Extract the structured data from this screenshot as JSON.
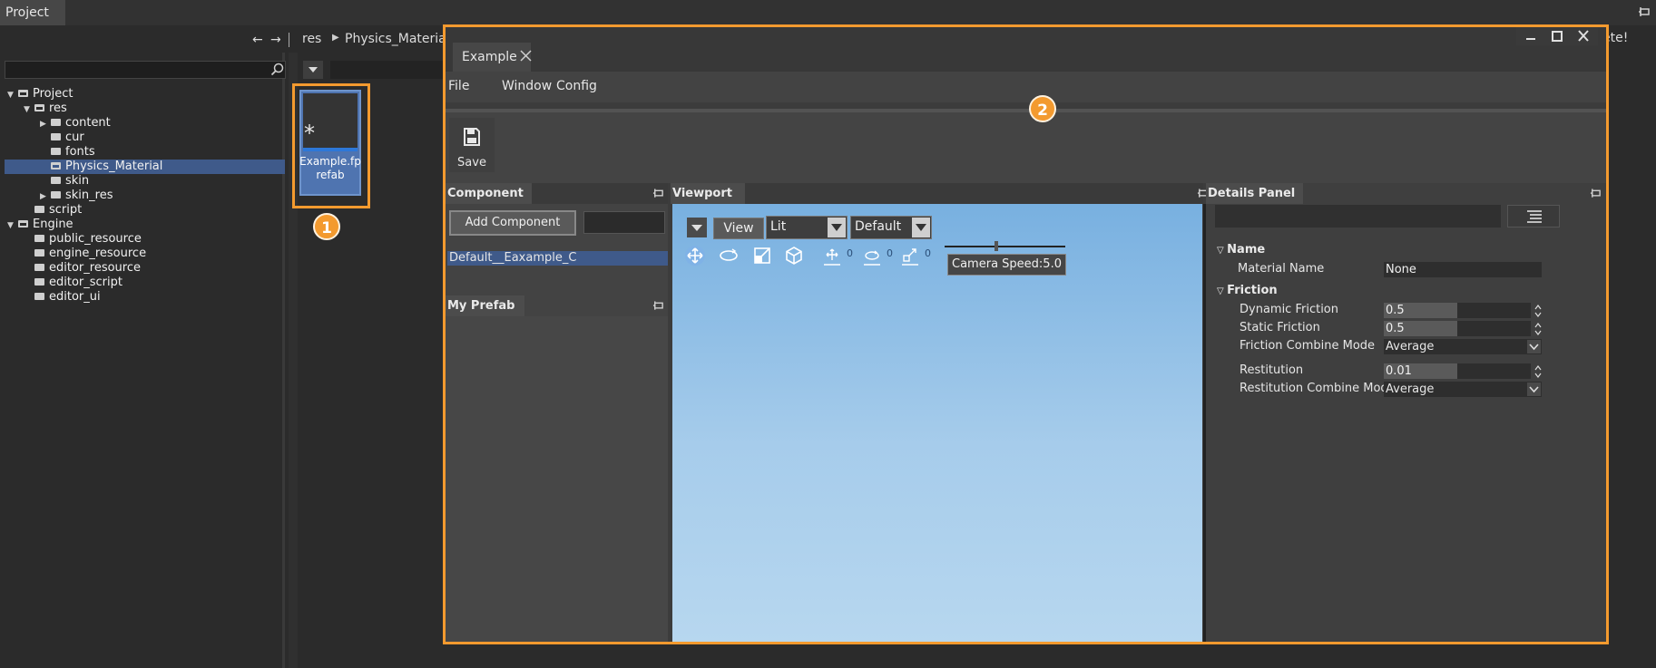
{
  "project": {
    "tab_label": "Project",
    "breadcrumb": [
      "res",
      "Physics_Material"
    ],
    "tree": [
      {
        "label": "Project",
        "depth": 0,
        "arrow": "open",
        "open": true
      },
      {
        "label": "res",
        "depth": 1,
        "arrow": "open",
        "open": true
      },
      {
        "label": "content",
        "depth": 2,
        "arrow": "closed",
        "open": false
      },
      {
        "label": "cur",
        "depth": 2,
        "arrow": "none",
        "open": false
      },
      {
        "label": "fonts",
        "depth": 2,
        "arrow": "none",
        "open": false
      },
      {
        "label": "Physics_Material",
        "depth": 2,
        "arrow": "none",
        "open": true,
        "selected": true
      },
      {
        "label": "skin",
        "depth": 2,
        "arrow": "none",
        "open": false
      },
      {
        "label": "skin_res",
        "depth": 2,
        "arrow": "closed",
        "open": false
      },
      {
        "label": "script",
        "depth": 1,
        "arrow": "none",
        "open": false
      },
      {
        "label": "Engine",
        "depth": 0,
        "arrow": "open",
        "open": true
      },
      {
        "label": "public_resource",
        "depth": 1,
        "arrow": "none",
        "open": false
      },
      {
        "label": "engine_resource",
        "depth": 1,
        "arrow": "none",
        "open": false
      },
      {
        "label": "editor_resource",
        "depth": 1,
        "arrow": "none",
        "open": false
      },
      {
        "label": "editor_script",
        "depth": 1,
        "arrow": "none",
        "open": false
      },
      {
        "label": "editor_ui",
        "depth": 1,
        "arrow": "none",
        "open": false
      }
    ],
    "file": {
      "name": "Example.fprefab",
      "glyph": "*"
    },
    "background_note": "ete!"
  },
  "badges": {
    "one": "1",
    "two": "2"
  },
  "window": {
    "tab_label": "Example",
    "menu": [
      "File",
      "Window",
      "Config"
    ],
    "toolbar": {
      "save_label": "Save"
    },
    "component_panel": {
      "title": "Component",
      "add_button": "Add Component",
      "items": [
        "Default__Eaxample_C"
      ]
    },
    "prefab_panel": {
      "title": "My Prefab"
    },
    "viewport": {
      "title": "Viewport",
      "view_button": "View",
      "mode_select": "Lit",
      "preset_select": "Default",
      "gizmos": [
        {
          "icon": "move-icon",
          "count": ""
        },
        {
          "icon": "rotate-icon",
          "count": ""
        },
        {
          "icon": "scale-icon",
          "count": ""
        },
        {
          "icon": "cube-icon",
          "count": ""
        },
        {
          "icon": "move-snap-icon",
          "count": "0"
        },
        {
          "icon": "rotate-snap-icon",
          "count": "0"
        },
        {
          "icon": "scale-snap-icon",
          "count": "0"
        }
      ],
      "camera_speed_label": "Camera Speed:5.0",
      "camera_speed_fraction": 0.43
    },
    "details": {
      "title": "Details Panel",
      "sections": [
        {
          "title": "Name",
          "props": [
            {
              "label": "Material Name",
              "type": "text",
              "value": "None"
            }
          ]
        },
        {
          "title": "Friction",
          "props": [
            {
              "label": "Dynamic Friction",
              "type": "number",
              "value": "0.5",
              "fill": 0.5
            },
            {
              "label": "Static Friction",
              "type": "number",
              "value": "0.5",
              "fill": 0.5
            },
            {
              "label": "Friction Combine Mode",
              "type": "dropdown",
              "value": "Average"
            },
            {
              "label": "Restitution",
              "type": "number",
              "value": "0.01",
              "fill": 0.5
            },
            {
              "label": "Restitution Combine Mode",
              "type": "dropdown",
              "value": "Average"
            }
          ]
        }
      ]
    }
  }
}
